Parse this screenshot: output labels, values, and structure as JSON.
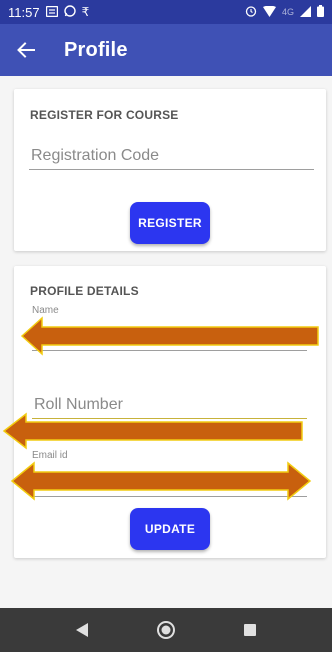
{
  "status_bar": {
    "time": "11:57",
    "network": "4G"
  },
  "app_bar": {
    "title": "Profile"
  },
  "register_card": {
    "heading": "REGISTER FOR COURSE",
    "registration_code_placeholder": "Registration Code",
    "register_label": "REGISTER"
  },
  "profile_card": {
    "heading": "PROFILE DETAILS",
    "name_label": "Name",
    "roll_number_placeholder": "Roll Number",
    "email_label": "Email id",
    "update_label": "UPDATE"
  },
  "colors": {
    "status_bar": "#2b3a9e",
    "app_bar": "#3f51b5",
    "button": "#2c36f0",
    "annotation_arrow": "#c8600e",
    "annotation_outline": "#f2cc10",
    "nav_bar": "#3a3a3a"
  },
  "icons": {
    "back": "arrow-left-icon",
    "nav_back": "triangle-left-icon",
    "nav_home": "circle-home-icon",
    "nav_recents": "square-recents-icon"
  }
}
